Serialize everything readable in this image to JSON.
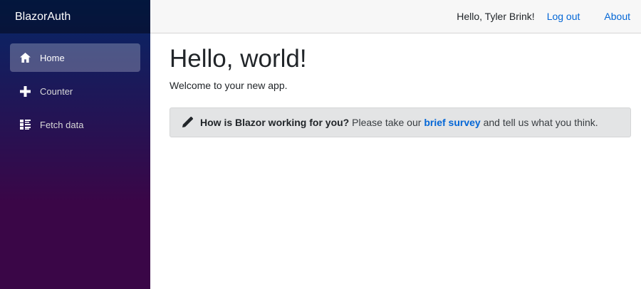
{
  "sidebar": {
    "brand": "BlazorAuth",
    "items": [
      {
        "label": "Home",
        "icon": "home-icon",
        "active": true
      },
      {
        "label": "Counter",
        "icon": "plus-icon",
        "active": false
      },
      {
        "label": "Fetch data",
        "icon": "list-rich-icon",
        "active": false
      }
    ]
  },
  "top_bar": {
    "greeting": "Hello, Tyler Brink!",
    "logout": "Log out",
    "about": "About"
  },
  "main": {
    "title": "Hello, world!",
    "welcome": "Welcome to your new app.",
    "survey": {
      "icon": "pencil-icon",
      "question": "How is Blazor working for you?",
      "prefix": "Please take our",
      "link": "brief survey",
      "suffix": "and tell us what you think."
    }
  },
  "colors": {
    "link": "#0366d6",
    "sidebar_top": "#052767",
    "sidebar_bottom": "#3a0647"
  }
}
